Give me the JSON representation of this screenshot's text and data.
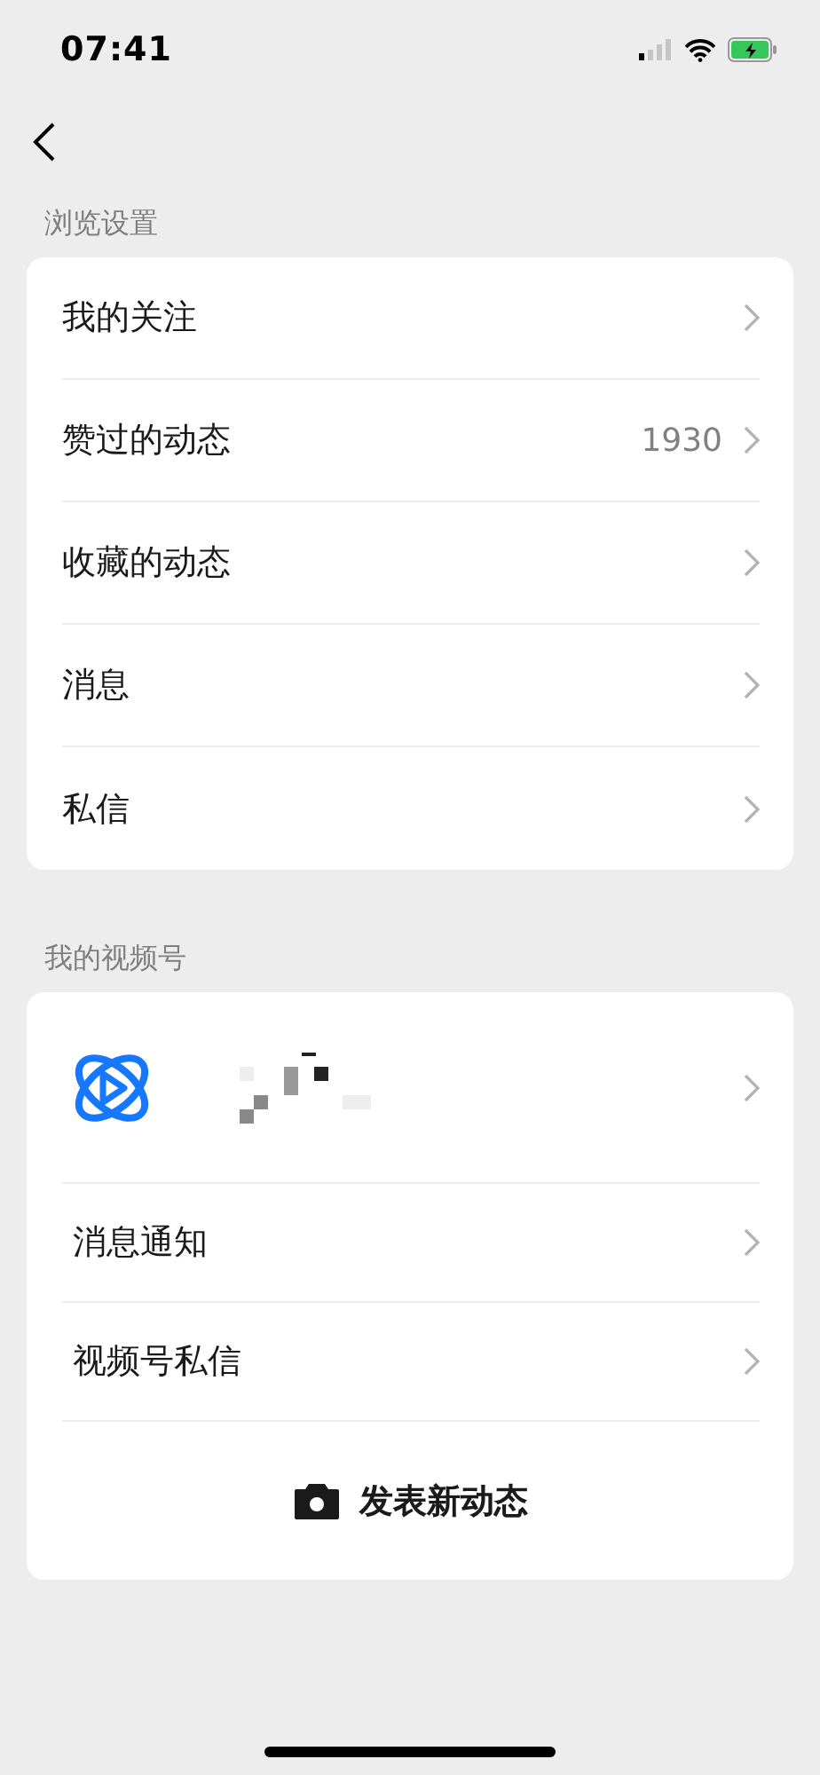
{
  "status_bar": {
    "time": "07:41"
  },
  "sections": [
    {
      "title": "浏览设置",
      "rows": [
        {
          "kind": "link",
          "label": "我的关注"
        },
        {
          "kind": "link",
          "label": "赞过的动态",
          "value": "1930"
        },
        {
          "kind": "link",
          "label": "收藏的动态"
        },
        {
          "kind": "link",
          "label": "消息"
        },
        {
          "kind": "link",
          "label": "私信"
        }
      ]
    },
    {
      "title": "我的视频号",
      "rows": [
        {
          "kind": "profile"
        },
        {
          "kind": "link",
          "label": "消息通知"
        },
        {
          "kind": "link",
          "label": "视频号私信"
        },
        {
          "kind": "action",
          "label": "发表新动态"
        }
      ]
    }
  ]
}
